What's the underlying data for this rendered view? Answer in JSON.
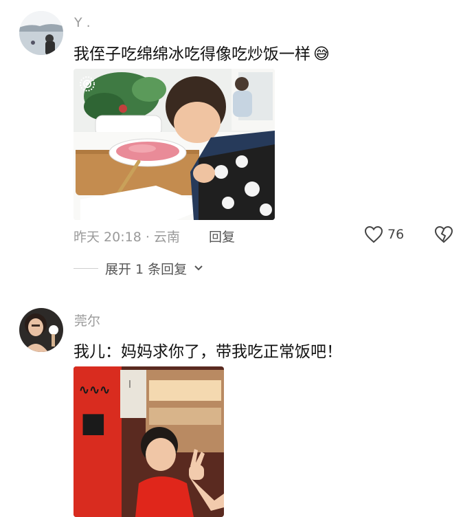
{
  "comments": [
    {
      "username": "Y .",
      "text": "我侄子吃绵绵冰吃得像吃炒饭一样",
      "emoji": "😅",
      "meta": "昨天 20:18 · 云南",
      "reply_label": "回复",
      "likes": "76",
      "expand_label": "展开 1 条回复"
    },
    {
      "username": "莞尔",
      "text": "我儿：妈妈求你了，带我吃正常饭吧！"
    }
  ],
  "icons": {
    "like": "heart-icon",
    "dislike": "broken-heart-icon",
    "expand": "chevron-down-icon",
    "live": "live-photo-icon"
  },
  "colors": {
    "meta_gray": "#9a9a9a",
    "text": "#111111"
  }
}
